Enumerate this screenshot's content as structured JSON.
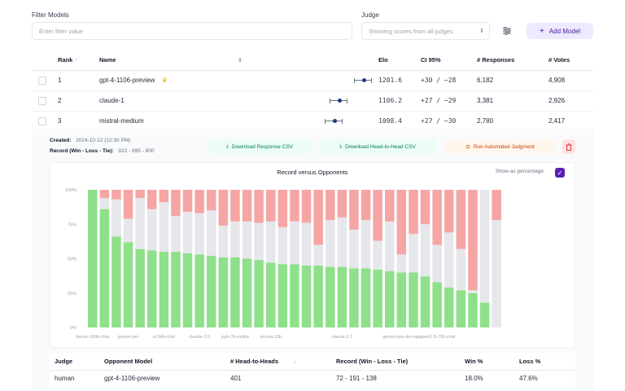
{
  "filter": {
    "label": "Filter Models",
    "placeholder": "Enter filter value"
  },
  "judge": {
    "label": "Judge",
    "value": "Showing scores from all judges"
  },
  "icons": {
    "settings": "sliders-icon",
    "add": "plus-icon",
    "delete": "trash-icon",
    "download": "download-icon",
    "judge": "scale-icon",
    "check": "checkmark-icon",
    "star": "crown-icon"
  },
  "add_button": {
    "label": "Add Model"
  },
  "models_table": {
    "headers": {
      "rank": "Rank",
      "rank_sort": "↑",
      "name": "Name",
      "elo": "Elo",
      "ci": "CI 95%",
      "responses": "# Responses",
      "votes": "# Votes"
    },
    "rows": [
      {
        "rank": "1",
        "name": "gpt-4-1106-preview",
        "elo": "1201.6",
        "ci": "+30 / −28",
        "responses": "6,182",
        "votes": "4,908"
      },
      {
        "rank": "2",
        "name": "claude-1",
        "elo": "1106.2",
        "ci": "+27 / −29",
        "responses": "3,381",
        "votes": "2,926"
      },
      {
        "rank": "3",
        "name": "mistral-medium",
        "elo": "1098.4",
        "ci": "+27 / −30",
        "responses": "2,780",
        "votes": "2,417"
      }
    ]
  },
  "detail": {
    "created_label": "Created:",
    "created_value": "2024-10-12 (12:30 PM)",
    "record_label": "Record (Win - Loss - Tie):",
    "record_value": "922 - 695 - 800",
    "btn_download_responses": "Download Response CSV",
    "btn_download_h2h": "Download Head-to-Head CSV",
    "btn_run_judgment": "Run Automated Judgment"
  },
  "chart": {
    "show_percentage_label": "Show as percentage",
    "show_percentage": true,
    "colors": {
      "win": "#8ee08a",
      "tie": "#e5e7eb",
      "loss": "#f6a5a5"
    }
  },
  "chart_data": {
    "type": "bar",
    "stacked": true,
    "title": "Record versus Opponents",
    "ylim": [
      0,
      100
    ],
    "yticks": [
      "0%",
      "25%",
      "50%",
      "75%",
      "100%"
    ],
    "categories": [
      "falcon-180b-chat",
      "",
      "",
      "gemini-pro",
      "",
      "",
      "yi-34b-chat",
      "",
      "",
      "claude-2.0",
      "",
      "",
      "pplx-7b-online",
      "",
      "",
      "vicuna-33b",
      "",
      "",
      "",
      "",
      "",
      "claude-2.1",
      "",
      "",
      "",
      "",
      "gemini-pro-dev-api",
      "",
      "",
      "qwen1.5-72b-chat",
      "",
      "",
      "",
      ""
    ],
    "series": [
      {
        "name": "Win",
        "values": [
          100,
          86,
          66,
          62,
          57,
          56,
          55,
          55,
          54,
          53,
          52,
          51,
          51,
          50,
          49,
          47,
          46,
          46,
          45,
          45,
          44,
          44,
          43,
          43,
          42,
          41,
          40,
          40,
          37,
          33,
          29,
          27,
          25,
          18
        ]
      },
      {
        "name": "Tie",
        "values": [
          0,
          8,
          27,
          17,
          37,
          30,
          36,
          26,
          30,
          30,
          33,
          23,
          26,
          27,
          27,
          30,
          27,
          31,
          31,
          15,
          34,
          36,
          28,
          35,
          21,
          36,
          13,
          28,
          38,
          27,
          40,
          30,
          2,
          82
        ]
      },
      {
        "name": "Loss",
        "values": [
          0,
          6,
          7,
          21,
          6,
          14,
          9,
          19,
          16,
          17,
          15,
          26,
          23,
          23,
          24,
          23,
          27,
          23,
          24,
          40,
          22,
          20,
          29,
          22,
          37,
          23,
          47,
          32,
          25,
          40,
          31,
          43,
          73,
          0
        ]
      }
    ],
    "extra_bars": [
      {
        "win": 0,
        "tie": 78,
        "loss": 22
      }
    ]
  },
  "opponents_table": {
    "headers": {
      "judge": "Judge",
      "opponent": "Opponent Model",
      "h2h": "# Head-to-Heads",
      "h2h_sort": "↓",
      "record": "Record (Win - Loss - Tie)",
      "win": "Win %",
      "loss": "Loss %"
    },
    "rows": [
      {
        "judge": "human",
        "opponent": "gpt-4-1106-preview",
        "h2h": "401",
        "record": "72 - 191 - 138",
        "win": "18.0%",
        "loss": "47.6%"
      }
    ]
  }
}
